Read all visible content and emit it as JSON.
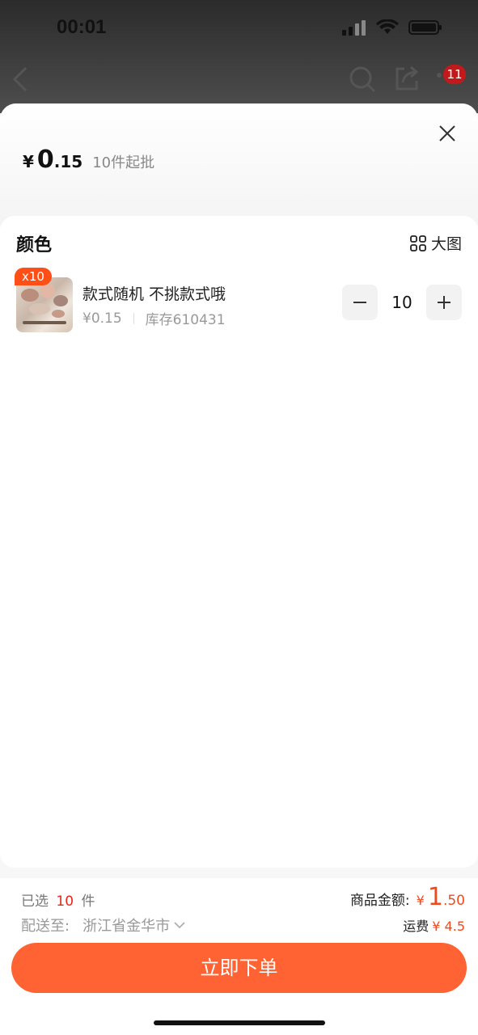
{
  "status_bar": {
    "time": "00:01"
  },
  "nav": {
    "cart_count": "11"
  },
  "sheet": {
    "price": {
      "currency": "¥",
      "integer": "0",
      "decimal": ".15",
      "moq": "10件起批"
    }
  },
  "sku_section": {
    "title": "颜色",
    "big_pic_label": "大图",
    "items": [
      {
        "qty_badge": "x10",
        "name": "款式随机 不挑款式哦",
        "price": "¥0.15",
        "stock": "库存610431",
        "quantity": "10"
      }
    ]
  },
  "footer": {
    "selected_prefix": "已选",
    "selected_count": "10",
    "selected_suffix": "件",
    "ship_label": "配送至:",
    "ship_address": "浙江省金华市",
    "total_label": "商品金额:",
    "total_currency": "¥",
    "total_integer": "1",
    "total_decimal": ".50",
    "freight_label": "运费",
    "freight_value": "¥ 4.5",
    "order_button": "立即下单"
  },
  "colors": {
    "accent": "#ff6333",
    "price_red": "#f04a1c",
    "badge_orange": "#ff4f17"
  }
}
